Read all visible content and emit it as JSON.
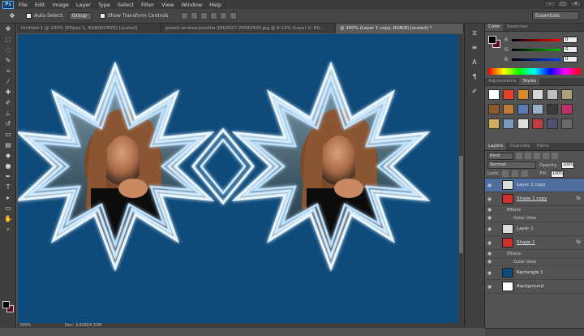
{
  "app": {
    "logo": "Ps"
  },
  "menu": [
    "File",
    "Edit",
    "Image",
    "Layer",
    "Type",
    "Select",
    "Filter",
    "View",
    "Window",
    "Help"
  ],
  "window_controls": [
    "–",
    "□",
    "×"
  ],
  "options_bar": {
    "auto_select_label": "Auto-Select:",
    "auto_select_value": "Group",
    "show_transform_label": "Show Transform Controls",
    "workspace": "Essentials"
  },
  "tabs": [
    {
      "label": "Untitled-1 @ 100% (Ellipse 1, RGB/8/CMYK) [scaled]",
      "active": false
    },
    {
      "label": "pexels-andrea-procbio-3062027-29582505.jpg @ 9.12% (Layer 0, RG...",
      "active": false
    },
    {
      "label": "@ 200% (Layer 1 copy, RGB/8) [scaled] *",
      "active": true
    }
  ],
  "status_bar": {
    "zoom": "200%",
    "doc": "Doc: 3.62M/4.33M"
  },
  "panels": {
    "color": {
      "tabs": [
        "Color",
        "Swatches"
      ],
      "sliders": [
        {
          "label": "R",
          "value": "0",
          "gradient": "#ff0000"
        },
        {
          "label": "G",
          "value": "0",
          "gradient": "#00c000"
        },
        {
          "label": "B",
          "value": "0",
          "gradient": "#0040ff"
        }
      ],
      "foreground": "#000000",
      "background": "#5c0d34"
    },
    "styles": {
      "tabs": [
        "Adjustments",
        "Styles"
      ],
      "swatches": [
        "#ffffff",
        "#e8402a",
        "#d88a2a",
        "#d8d8d8",
        "#bfbfbf",
        "#b0a07a",
        "#8a5a2a",
        "#c07a3a",
        "#5a7ab0",
        "#9ab0c8",
        "#3a3a3a",
        "#c0306a",
        "#d0b060",
        "#7a9ac0",
        "#e0e0e0",
        "#c04040",
        "#505070",
        "#6a6a6a"
      ]
    },
    "layers": {
      "tabs": [
        "Layers",
        "Channels",
        "Paths"
      ],
      "kind_label": "Kind",
      "blend_mode": "Normal",
      "opacity_label": "Opacity:",
      "opacity_value": "100%",
      "lock_label": "Lock:",
      "fill_label": "Fill:",
      "fill_value": "100%",
      "items": [
        {
          "name": "Layer 1 copy",
          "selected": true,
          "thumb": "#dcdcdc",
          "fx": "",
          "underline": false
        },
        {
          "name": "Shape 1 copy",
          "selected": false,
          "thumb": "#d03030",
          "fx": "fx",
          "underline": true,
          "effects_label": "Effects",
          "effect": "Outer Glow"
        },
        {
          "name": "Layer 1",
          "selected": false,
          "thumb": "#dcdcdc",
          "fx": "",
          "underline": false
        },
        {
          "name": "Shape 1",
          "selected": false,
          "thumb": "#d03030",
          "fx": "fx",
          "underline": true,
          "effects_label": "Effects",
          "effect": "Outer Glow"
        },
        {
          "name": "Rectangle 1",
          "selected": false,
          "thumb": "#0e4a7a",
          "fx": "",
          "underline": false
        },
        {
          "name": "Background",
          "selected": false,
          "thumb": "#ffffff",
          "fx": "",
          "underline": false
        }
      ]
    }
  },
  "canvas": {
    "background": "#0e4a7a"
  }
}
